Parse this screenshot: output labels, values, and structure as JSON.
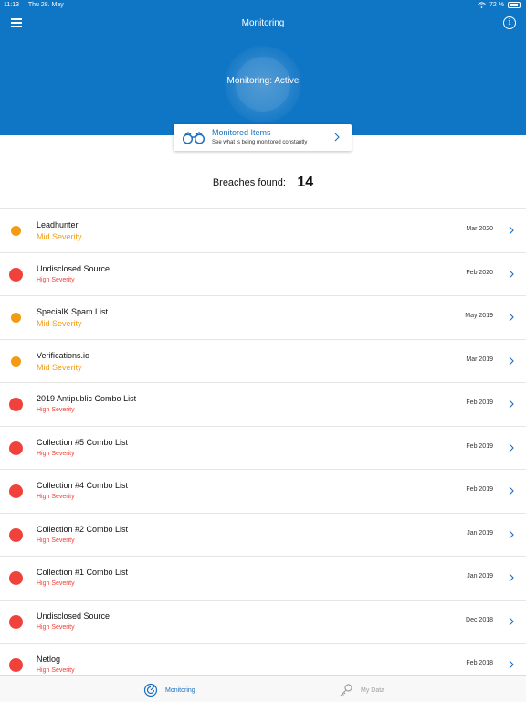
{
  "status_bar": {
    "time": "11:13",
    "date": "Thu 28. May",
    "battery": "72 %"
  },
  "header": {
    "title": "Monitoring",
    "monitoring_status": "Monitoring: Active",
    "bg_color": "#0f75c5"
  },
  "monitored_items": {
    "title": "Monitored Items",
    "subtitle": "See what is being monitored constantly"
  },
  "breaches": {
    "label": "Breaches found:",
    "count": "14"
  },
  "colors": {
    "mid_severity": "#f39c12",
    "high_severity": "#f0413a",
    "accent": "#1b6fbf"
  },
  "breach_list": [
    {
      "name": "Leadhunter",
      "severity": "Mid Severity",
      "level": "mid",
      "date": "Mar 2020"
    },
    {
      "name": "Undisclosed Source",
      "severity": "High Severity",
      "level": "high",
      "date": "Feb 2020"
    },
    {
      "name": "SpecialK Spam List",
      "severity": "Mid Severity",
      "level": "mid",
      "date": "May 2019"
    },
    {
      "name": "Verifications.io",
      "severity": "Mid Severity",
      "level": "mid",
      "date": "Mar 2019"
    },
    {
      "name": "2019 Antipublic Combo List",
      "severity": "High Severity",
      "level": "high",
      "date": "Feb 2019"
    },
    {
      "name": "Collection #5 Combo List",
      "severity": "High Severity",
      "level": "high",
      "date": "Feb 2019"
    },
    {
      "name": "Collection #4 Combo List",
      "severity": "High Severity",
      "level": "high",
      "date": "Feb 2019"
    },
    {
      "name": "Collection #2 Combo List",
      "severity": "High Severity",
      "level": "high",
      "date": "Jan 2019"
    },
    {
      "name": "Collection #1 Combo List",
      "severity": "High Severity",
      "level": "high",
      "date": "Jan 2019"
    },
    {
      "name": "Undisclosed Source",
      "severity": "High Severity",
      "level": "high",
      "date": "Dec 2018"
    },
    {
      "name": "Netlog",
      "severity": "High Severity",
      "level": "high",
      "date": "Feb 2018"
    }
  ],
  "tabs": [
    {
      "label": "Monitoring",
      "icon": "radar-icon",
      "active": true
    },
    {
      "label": "My Data",
      "icon": "key-icon",
      "active": false
    }
  ]
}
